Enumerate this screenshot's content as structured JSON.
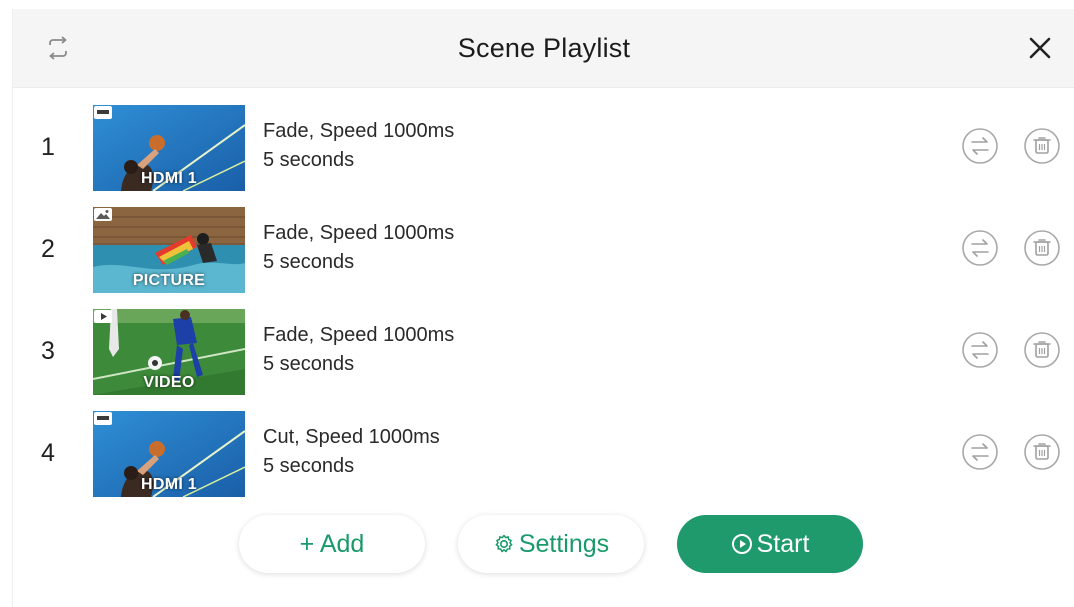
{
  "header": {
    "title": "Scene Playlist",
    "loop_icon": "loop-icon",
    "close_icon": "close-icon"
  },
  "rows": [
    {
      "number": "1",
      "source": "HDMI 1",
      "source_icon": "hdmi-icon",
      "transition": "Fade, Speed 1000ms",
      "duration": "5 seconds"
    },
    {
      "number": "2",
      "source": "PICTURE",
      "source_icon": "image-icon",
      "transition": "Fade, Speed 1000ms",
      "duration": "5 seconds"
    },
    {
      "number": "3",
      "source": "VIDEO",
      "source_icon": "play-icon",
      "transition": "Fade, Speed 1000ms",
      "duration": "5 seconds"
    },
    {
      "number": "4",
      "source": "HDMI 1",
      "source_icon": "hdmi-icon",
      "transition": "Cut, Speed 1000ms",
      "duration": "5 seconds"
    }
  ],
  "actions": {
    "add_label": "+ Add",
    "settings_label": "Settings",
    "start_label": "Start"
  },
  "colors": {
    "accent": "#1e9a6d",
    "header_bg": "#f5f5f5",
    "icon_gray": "#9a9a9a"
  }
}
